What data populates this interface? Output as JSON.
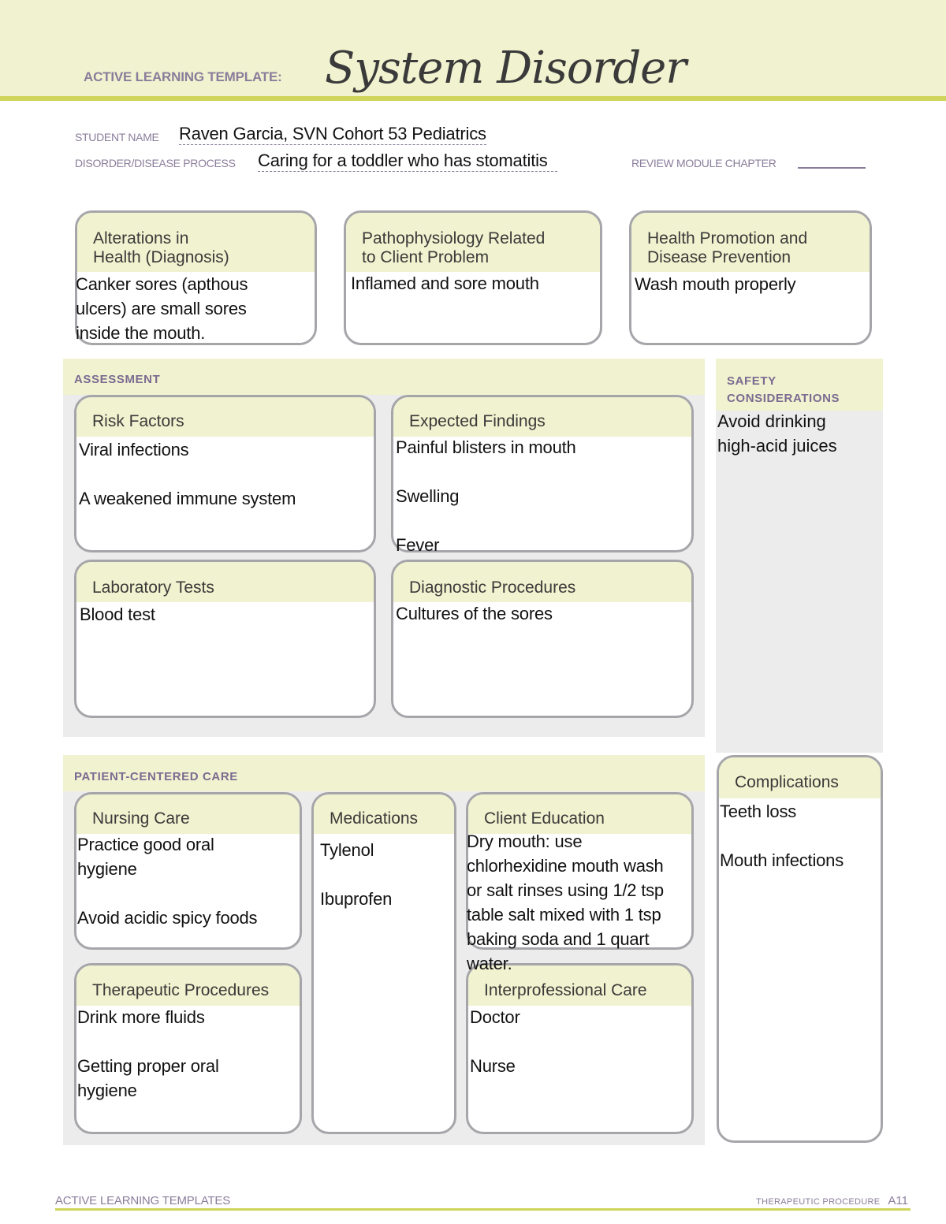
{
  "header": {
    "label": "ACTIVE LEARNING TEMPLATE:",
    "title": "System Disorder"
  },
  "fields": {
    "student_name_label": "STUDENT NAME",
    "student_name_value": "Raven Garcia, SVN Cohort 53 Pediatrics",
    "disorder_label": "DISORDER/DISEASE PROCESS",
    "disorder_value": "Caring for a toddler who has stomatitis",
    "review_module_label": "REVIEW MODULE CHAPTER",
    "review_module_value": ""
  },
  "top_boxes": [
    {
      "title": "Alterations in\nHealth (Diagnosis)",
      "body": "Canker sores (apthous\nulcers) are small sores\ninside the mouth."
    },
    {
      "title": "Pathophysiology Related\nto Client Problem",
      "body": "Inflamed and sore mouth"
    },
    {
      "title": "Health Promotion and\nDisease Prevention",
      "body": "Wash mouth properly"
    }
  ],
  "assessment": {
    "section_title": "ASSESSMENT",
    "risk_factors": {
      "title": "Risk Factors",
      "body": "Viral infections\n\nA weakened immune system"
    },
    "expected_findings": {
      "title": "Expected Findings",
      "body": "Painful blisters in mouth\n\nSwelling\n\nFever"
    },
    "laboratory_tests": {
      "title": "Laboratory Tests",
      "body": "Blood test"
    },
    "diagnostic_procedures": {
      "title": "Diagnostic Procedures",
      "body": "Cultures of the sores"
    }
  },
  "safety": {
    "title": "SAFETY\nCONSIDERATIONS",
    "body": "Avoid drinking\nhigh-acid juices"
  },
  "patient_centered_care": {
    "section_title": "PATIENT-CENTERED CARE",
    "nursing_care": {
      "title": "Nursing Care",
      "body": "Practice good oral\nhygiene\n\nAvoid acidic spicy foods"
    },
    "medications": {
      "title": "Medications",
      "body": "Tylenol\n\nIbuprofen"
    },
    "client_education": {
      "title": "Client Education",
      "body": "Dry mouth: use\nchlorhexidine mouth wash\nor salt rinses using 1/2 tsp\ntable salt mixed with 1 tsp\nbaking soda and 1 quart\nwater."
    },
    "therapeutic_procedures": {
      "title": "Therapeutic Procedures",
      "body": "Drink more fluids\n\nGetting proper oral\nhygiene"
    },
    "interprofessional_care": {
      "title": "Interprofessional Care",
      "body": "Doctor\n\nNurse"
    }
  },
  "complications": {
    "title": "Complications",
    "body": "Teeth loss\n\nMouth infections"
  },
  "footer": {
    "left": "ACTIVE LEARNING TEMPLATES",
    "right_label": "THERAPEUTIC PROCEDURE",
    "page": "A11"
  }
}
